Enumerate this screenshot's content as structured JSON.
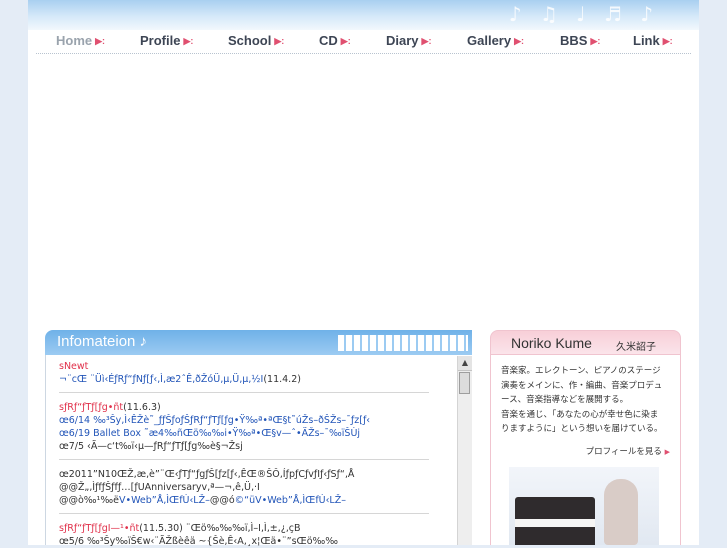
{
  "header": {
    "decoration_notes": "♪ ♫ ♩ ♬ ♪"
  },
  "nav": {
    "items": [
      {
        "label": "Home",
        "name": "nav-home"
      },
      {
        "label": "Profile",
        "name": "nav-profile"
      },
      {
        "label": "School",
        "name": "nav-school"
      },
      {
        "label": "CD",
        "name": "nav-cd"
      },
      {
        "label": "Diary",
        "name": "nav-diary"
      },
      {
        "label": "Gallery",
        "name": "nav-gallery"
      },
      {
        "label": "BBS",
        "name": "nav-bbs"
      },
      {
        "label": "Link",
        "name": "nav-link"
      }
    ],
    "arrow": "▶:"
  },
  "info": {
    "title": "Infomateion ♪",
    "lines": {
      "l1": "sNewt",
      "l2a": "¬¨cŒ ¨Üì‹ÉƒRƒ“ƒNƒ[ƒ‹‚Ì‚æ2ˆÊ‚ðŽóÜ‚µ‚Ü‚µ‚½I",
      "l2b": "(11.4.2)",
      "l3a": "sƒRƒ“ƒTƒ[ƒg•ñt",
      "l3b": "(11.6.3)",
      "l4": "œ6/14 ‰³Šy‚Ì‹ÊŽè˜_ƒƒŠƒoƒŠƒRƒ“ƒTƒ[ƒg•Ÿ‰ª•ªŒ§t˜úŽs–ðŠŽs–¯ƒz[ƒ‹",
      "l5": "œ6/19 Ballet Box ˜æ4‰ñŒö‰‰i•Ÿ‰ª•Œ§v—ˆ•ÄŽs–¯‰ïŠÙj",
      "l6": "œ7/5 ‹Ã—c‘t‰ï‹µ—ƒRƒ“ƒTƒ[ƒg‰è§¬Žsj",
      "l7": "œ2011”N10ŒŽ‚æ‚è”¨Œ‹ƒTƒ“ƒgƒŠ[ƒz[ƒ‹‚ÊŒ®ŠÔ‚ÍƒpƒCƒvƒIƒ‹ƒSƒ“‚Å",
      "l8": "@@Ž„‚ÌƒfƒŠƒfƒ…[ƒUAnniversaryv‚ª—¬‚ê‚Ü‚·I",
      "l9a": "@@ò‰¹‰ë",
      "l9b": "V•Web”Å‚ÌŒfÚ‹LŽ–",
      "l9c": "@@ó",
      "l9d": "©“üV•Web”Å‚ÌŒfÚ‹LŽ–",
      "l10a": "sƒRƒ“ƒTƒ[ƒgI—¹•ñt",
      "l10b": "(11.5.30) ¨Œö‰‰‰ï‚Ì–I‚Ì‚±‚¿‚çB",
      "l11": "œ5/6 ‰³Šy‰ïŠ€w‹¨ÃŽßèêä ~{Šè‚Ê‹A‚¸x¦Œä•¨”sŒö‰‰"
    }
  },
  "profile": {
    "name_en": "Noriko Kume",
    "name_jp": "久米詔子",
    "bio": [
      "音楽家。エレクトーン、ピアノのステージ",
      "演奏をメインに、作・編曲、音楽プロデュ",
      "ース、音楽指導などを展開する。",
      "音楽を通じ、「あなたの心が幸せ色に染ま",
      "りますように」という想いを届けている。"
    ],
    "more_link": "プロフィールを見る",
    "more_arrow": "▶"
  },
  "scrollbar": {
    "up_arrow": "▲"
  }
}
